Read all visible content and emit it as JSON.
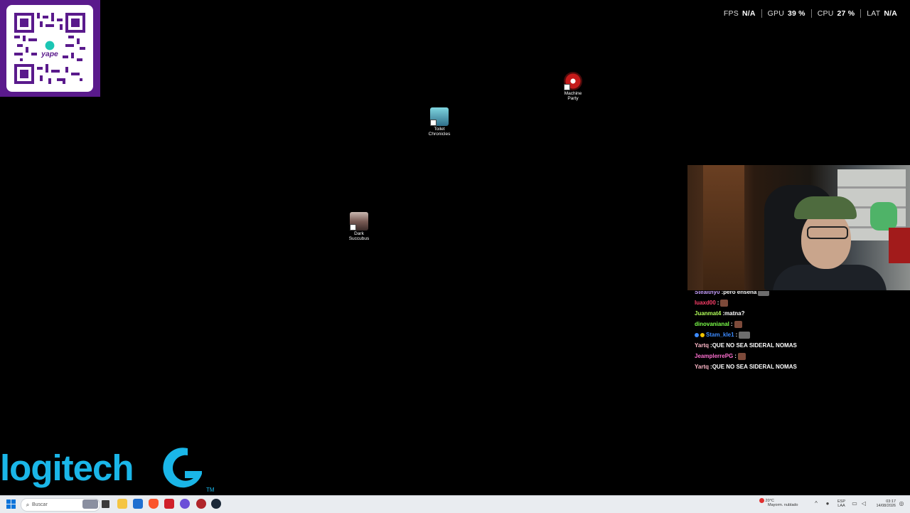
{
  "perf_overlay": {
    "items": [
      {
        "label": "FPS",
        "value": "N/A"
      },
      {
        "label": "GPU",
        "value": "39 %"
      },
      {
        "label": "CPU",
        "value": "27 %"
      },
      {
        "label": "LAT",
        "value": "N/A"
      }
    ]
  },
  "qr_overlay": {
    "brand": "yape",
    "icon": "qr-code-icon"
  },
  "desktop_icons": [
    {
      "label_line1": "Machine",
      "label_line2": "Party",
      "icon": "machine-party-icon"
    },
    {
      "label_line1": "Toilet",
      "label_line2": "Chronicles",
      "icon": "toilet-chronicles-icon"
    },
    {
      "label_line1": "Dark",
      "label_line2": "Succubus",
      "icon": "dark-succubus-icon"
    }
  ],
  "webcam": {
    "icon": "webcam-feed"
  },
  "chat": {
    "messages": [
      {
        "user": "Stealthy0",
        "separator": " : ",
        "text": "pero enseña",
        "color": "#c8a0ff",
        "emote": "gray"
      },
      {
        "user": "luaxd00",
        "separator": " : ",
        "text": "",
        "color": "#ff3f6a",
        "emote": "brown"
      },
      {
        "user": "Juanmat4",
        "separator": " : ",
        "text": "matna?",
        "color": "#b2ff5a",
        "emote": ""
      },
      {
        "user": "dinovanianal",
        "separator": " : ",
        "text": "",
        "color": "#7cff4a",
        "emote": "brown"
      },
      {
        "user": "Stam_kle1",
        "separator": " : ",
        "text": "",
        "color": "#3d8bff",
        "emote": "gray"
      },
      {
        "user": "Yartq",
        "separator": " : ",
        "text": "QUE NO SEA SIDERAL NOMAS",
        "color": "#ffb8c8",
        "emote": ""
      },
      {
        "user": "JeamplerrePG",
        "separator": " : ",
        "text": "",
        "color": "#ff6fd0",
        "emote": "brown"
      },
      {
        "user": "Yartq",
        "separator": " : ",
        "text": "QUE NO SEA SIDERAL NOMAS",
        "color": "#ffb8c8",
        "emote": ""
      }
    ]
  },
  "logo": {
    "text": "logitech",
    "mark": "G",
    "tm": "TM",
    "color": "#1ab6e8"
  },
  "taskbar": {
    "start_icon": "windows-start-icon",
    "search_placeholder": "Buscar",
    "apps": [
      "task-view-icon",
      "file-explorer-icon",
      "store-icon",
      "brave-browser-icon",
      "media-app-icon",
      "discord-icon",
      "game-app-icon",
      "steam-icon"
    ],
    "weather_temp": "20°C",
    "weather_desc": "Mayorm. nublado",
    "lang_line1": "ESP",
    "lang_line2": "LAA",
    "time": "03:17",
    "date": "14/08/2026"
  }
}
